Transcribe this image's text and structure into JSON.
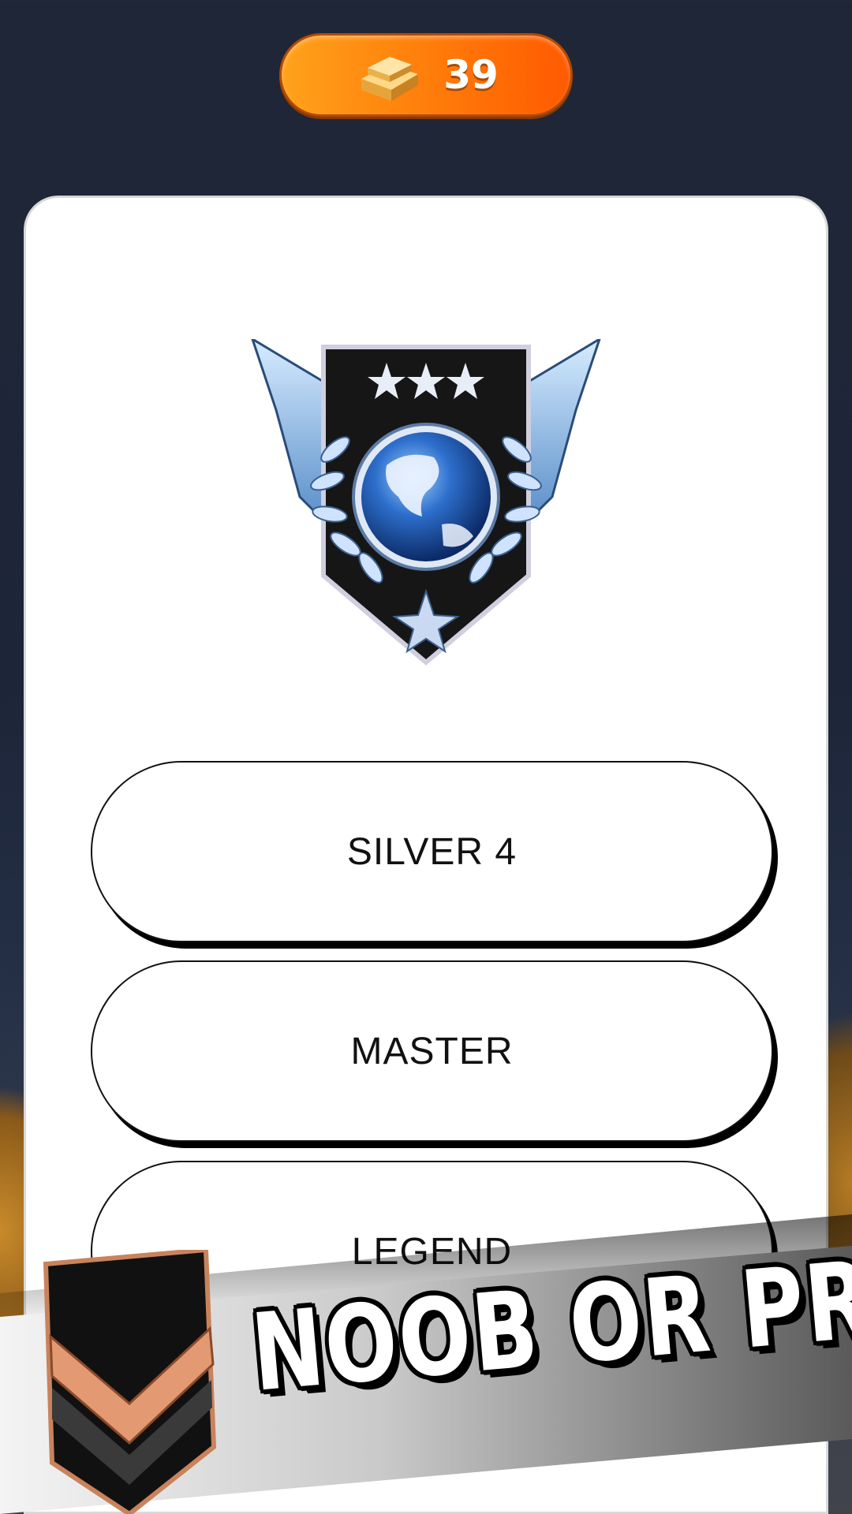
{
  "header": {
    "currency_icon": "gold-bar-icon",
    "currency_amount": "39",
    "pill_color": "#ff8a0c"
  },
  "quiz": {
    "emblem_icon": "rank-emblem-globe-icon",
    "answers": [
      {
        "label": "SILVER 4"
      },
      {
        "label": "MASTER"
      },
      {
        "label": "LEGEND"
      }
    ]
  },
  "banner": {
    "title": "NOOB OR PRO?",
    "badge_icon": "chevron-rank-badge-icon"
  }
}
